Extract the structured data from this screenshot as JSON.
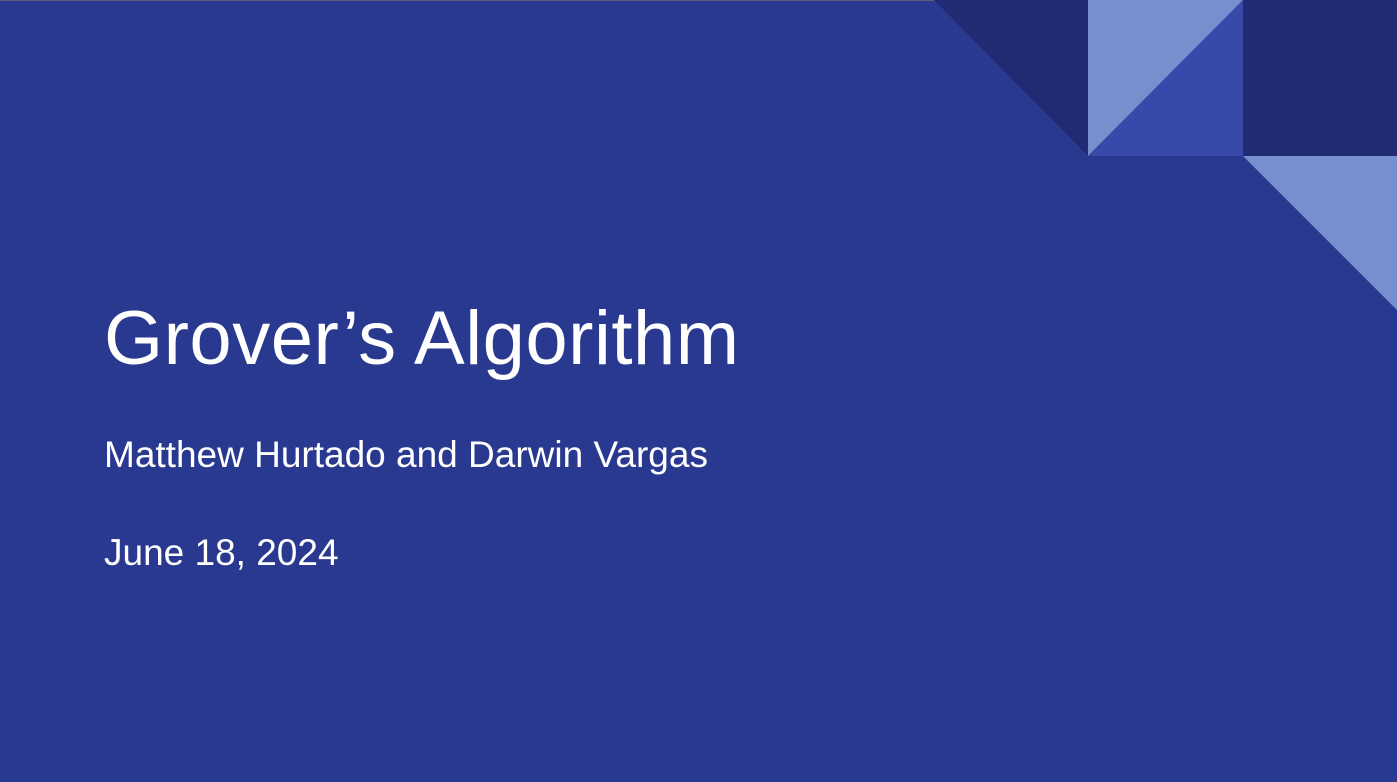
{
  "slide": {
    "title": "Grover’s Algorithm",
    "subtitle": "Matthew Hurtado and Darwin Vargas",
    "date": "June 18, 2024"
  },
  "colors": {
    "background": "#2a3990",
    "dark_accent": "#212b74",
    "light_accent": "#758fcf",
    "mid_accent": "#3949aa",
    "text": "#ffffff"
  }
}
